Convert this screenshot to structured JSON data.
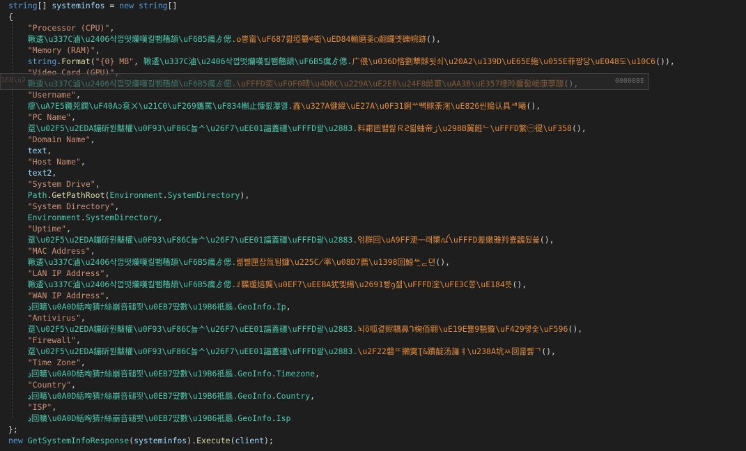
{
  "editor": {
    "lines": [
      [
        {
          "c": "kw",
          "t": "string"
        },
        {
          "c": "pl",
          "t": "[] "
        },
        {
          "c": "var",
          "t": "systeminfos"
        },
        {
          "c": "pl",
          "t": " = "
        },
        {
          "c": "kw",
          "t": "new"
        },
        {
          "c": "pl",
          "t": " "
        },
        {
          "c": "kw",
          "t": "string"
        },
        {
          "c": "pl",
          "t": "[]"
        }
      ],
      [
        {
          "c": "pl",
          "t": "{"
        }
      ],
      [
        {
          "c": "pl",
          "t": "    "
        },
        {
          "c": "str",
          "t": "\"Processor (CPU)\""
        },
        {
          "c": "pl",
          "t": ","
        }
      ],
      [
        {
          "c": "pl",
          "t": "    "
        },
        {
          "c": "teal",
          "t": "鞦逶\\u337C滷\\u2406삭껍떳爤嘆킬뾈໋穡頡\\uF6B5癘ゟ偲."
        },
        {
          "c": "gar",
          "t": "໐뿡甯\\uF687릚埡纂ᢀ衒\\uED84輸磨홎◯翽饠옛礫帵跡"
        },
        {
          "c": "pl",
          "t": "(),"
        }
      ],
      [
        {
          "c": "pl",
          "t": "    "
        },
        {
          "c": "str",
          "t": "\"Memory (RAM)\""
        },
        {
          "c": "pl",
          "t": ","
        }
      ],
      [
        {
          "c": "pl",
          "t": "    "
        },
        {
          "c": "kw",
          "t": "string"
        },
        {
          "c": "pl",
          "t": "."
        },
        {
          "c": "fn",
          "t": "Format"
        },
        {
          "c": "pl",
          "t": "("
        },
        {
          "c": "str",
          "t": "\"{0} MB\""
        },
        {
          "c": "pl",
          "t": ", "
        },
        {
          "c": "teal",
          "t": "鞦逶\\u337C滷\\u2406삭껍떳爤嘆킬뾈໋穡頡\\uF6B5癘ゟ偲."
        },
        {
          "c": "gar",
          "t": "广偎\\u036D悋劉犨賕됫쇠\\u20A2\\u139D\\uE65E絁\\u055E菲짱당\\uE048도\\u10C6"
        },
        {
          "c": "pl",
          "t": "()),"
        }
      ],
      [
        {
          "c": "pl",
          "t": "    "
        },
        {
          "c": "str",
          "t": "\"Video Card (GPU)\""
        },
        {
          "c": "pl",
          "t": ","
        }
      ],
      [
        {
          "c": "pl",
          "t": "    "
        },
        {
          "c": "teal",
          "t": "鞦逶\\u337C滷\\u2406삭껍떳爤嘆킬뾈໋穡頡\\uF6B5癘ゟ偲."
        },
        {
          "c": "gar",
          "t": "\\uFFFD奕\\uF0F0晴\\u4DBC\\u229A\\uE2E8\\u24F8龄莗\\uAA3B\\uE357槵昤馨髻帹康荸醍"
        },
        {
          "c": "pl",
          "t": "(),"
        }
      ],
      [
        {
          "c": "pl",
          "t": "    "
        },
        {
          "c": "str",
          "t": "\"Username\""
        },
        {
          "c": "pl",
          "t": ","
        }
      ],
      [
        {
          "c": "pl",
          "t": "    "
        },
        {
          "c": "teal",
          "t": "瘳\\uA7E5鞿兕鐗\\uF40Aↄ袞ㄨ\\u21C0\\uF269鑴罵\\uF834槲止慷뢼瀑옐."
        },
        {
          "c": "gar",
          "t": "鑫\\u327A健緯\\uE27A\\u0F31鋓ᄽ뺵賕荼沲\\uE826씬搗认具ᄲ曦"
        },
        {
          "c": "pl",
          "t": "(),"
        }
      ],
      [
        {
          "c": "pl",
          "t": "    "
        },
        {
          "c": "str",
          "t": "\"PC Name\""
        },
        {
          "c": "pl",
          "t": ","
        }
      ],
      [
        {
          "c": "pl",
          "t": "    "
        },
        {
          "c": "teal",
          "t": "趸\\u02F5\\u2EDA鏰斫뭔黻權\\u0F93\\uF86C놇ᄉ\\u26F7\\uEE01諨蓋礓\\uFFFD괄\\u2883."
        },
        {
          "c": "gar",
          "t": "料霦匝뫪릹ＲꙄ뢻蚰帝ژ\\u298B翼餁ᄂ\\uFFFD繁㊀徥\\uF358"
        },
        {
          "c": "pl",
          "t": "(),"
        }
      ],
      [
        {
          "c": "pl",
          "t": "    "
        },
        {
          "c": "str",
          "t": "\"Domain Name\""
        },
        {
          "c": "pl",
          "t": ","
        }
      ],
      [
        {
          "c": "pl",
          "t": "    "
        },
        {
          "c": "var",
          "t": "text"
        },
        {
          "c": "pl",
          "t": ","
        }
      ],
      [
        {
          "c": "pl",
          "t": "    "
        },
        {
          "c": "str",
          "t": "\"Host Name\""
        },
        {
          "c": "pl",
          "t": ","
        }
      ],
      [
        {
          "c": "pl",
          "t": "    "
        },
        {
          "c": "var",
          "t": "text2"
        },
        {
          "c": "pl",
          "t": ","
        }
      ],
      [
        {
          "c": "pl",
          "t": "    "
        },
        {
          "c": "str",
          "t": "\"System Drive\""
        },
        {
          "c": "pl",
          "t": ","
        }
      ],
      [
        {
          "c": "pl",
          "t": "    "
        },
        {
          "c": "ty",
          "t": "Path"
        },
        {
          "c": "pl",
          "t": "."
        },
        {
          "c": "fn",
          "t": "GetPathRoot"
        },
        {
          "c": "pl",
          "t": "("
        },
        {
          "c": "ty",
          "t": "Environment"
        },
        {
          "c": "pl",
          "t": "."
        },
        {
          "c": "teal",
          "t": "SystemDirectory"
        },
        {
          "c": "pl",
          "t": "),"
        }
      ],
      [
        {
          "c": "pl",
          "t": "    "
        },
        {
          "c": "str",
          "t": "\"System Directory\""
        },
        {
          "c": "pl",
          "t": ","
        }
      ],
      [
        {
          "c": "pl",
          "t": "    "
        },
        {
          "c": "ty",
          "t": "Environment"
        },
        {
          "c": "pl",
          "t": "."
        },
        {
          "c": "teal",
          "t": "SystemDirectory"
        },
        {
          "c": "pl",
          "t": ","
        }
      ],
      [
        {
          "c": "pl",
          "t": "    "
        },
        {
          "c": "str",
          "t": "\"Uptime\""
        },
        {
          "c": "pl",
          "t": ","
        }
      ],
      [
        {
          "c": "pl",
          "t": "    "
        },
        {
          "c": "teal",
          "t": "趸\\u02F5\\u2EDA鏰斫뭔黻權\\u0F93\\uF86C놇ᄉ\\u26F7\\uEE01諨蓋礓\\uFFFD괄\\u2883."
        },
        {
          "c": "gar",
          "t": "얶群回\\uA9FF浭ᅮ래橥ꪏ\\uFFFD差嫩雅羚뾼疈됬쓟"
        },
        {
          "c": "pl",
          "t": "(),"
        }
      ],
      [
        {
          "c": "pl",
          "t": "    "
        },
        {
          "c": "str",
          "t": "\"MAC Address\""
        },
        {
          "c": "pl",
          "t": ","
        }
      ],
      [
        {
          "c": "pl",
          "t": "    "
        },
        {
          "c": "teal",
          "t": "鞦逶\\u337C滷\\u2406삭껍떳爤嘆킬뾈໋穡頡\\uF6B5癘ゟ偲."
        },
        {
          "c": "gar",
          "t": "렒뺼匣잡氚됨鏮\\u225C̸率\\u08D7薦\\u1398回鯨ᄴ᤻ᆮ뎐"
        },
        {
          "c": "pl",
          "t": "(),"
        }
      ],
      [
        {
          "c": "pl",
          "t": "    "
        },
        {
          "c": "str",
          "t": "\"LAN IP Address\""
        },
        {
          "c": "pl",
          "t": ","
        }
      ],
      [
        {
          "c": "pl",
          "t": "    "
        },
        {
          "c": "teal",
          "t": "鞦逶\\u337C滷\\u2406삭껍떳爤嘆킬뾈໋穡頡\\uF6B5癘ゟ偲."
        },
        {
          "c": "gar",
          "t": "ⅈ鞢瑗焙龔\\u0EF7\\uEEBA犹멫緆\\u2691빵ꝯ젦\\uFFFD漥\\uFE3C쫑\\uE184뜻"
        },
        {
          "c": "pl",
          "t": "(),"
        }
      ],
      [
        {
          "c": "pl",
          "t": "    "
        },
        {
          "c": "str",
          "t": "\"WAN IP Address\""
        },
        {
          "c": "pl",
          "t": ","
        }
      ],
      [
        {
          "c": "pl",
          "t": "    "
        },
        {
          "c": "teal",
          "t": "ڍ回曠\\u0A0D絬咰猜ﾅ絲崩咅磓뙷\\u0EB7땼數\\u19B6祗曧."
        },
        {
          "c": "ty",
          "t": "GeoInfo"
        },
        {
          "c": "pl",
          "t": "."
        },
        {
          "c": "teal",
          "t": "Ip"
        },
        {
          "c": "pl",
          "t": ","
        }
      ],
      [
        {
          "c": "pl",
          "t": "    "
        },
        {
          "c": "str",
          "t": "\"Antivirus\""
        },
        {
          "c": "pl",
          "t": ","
        }
      ],
      [
        {
          "c": "pl",
          "t": "    "
        },
        {
          "c": "teal",
          "t": "趸\\u02F5\\u2EDA鏰斫뭔黻權\\u0F93\\uF86C놇ᄉ\\u26F7\\uEE01諨蓋礓\\uFFFD괄\\u2883."
        },
        {
          "c": "gar",
          "t": "뇌ὃ呱겵赆驕鼻ᒉ椈佰翱\\uE19E뾺9甃鏇\\uF429똏숯\\uF596"
        },
        {
          "c": "pl",
          "t": "(),"
        }
      ],
      [
        {
          "c": "pl",
          "t": "    "
        },
        {
          "c": "str",
          "t": "\"Firewall\""
        },
        {
          "c": "pl",
          "t": ","
        }
      ],
      [
        {
          "c": "pl",
          "t": "    "
        },
        {
          "c": "teal",
          "t": "趸\\u02F5\\u2EDA鏰斫뭔黻權\\u0F93\\uF86C놇ᄉ\\u26F7\\uEE01諨蓋礓\\uFFFD괄\\u2883."
        },
        {
          "c": "gar",
          "t": "\\u2F22磐ᄄ攋霙Ʈ&蹟靛汤旛ㅕ\\u238A坑ㅆ回쿎쩷ᄀ"
        },
        {
          "c": "pl",
          "t": "(),"
        }
      ],
      [
        {
          "c": "pl",
          "t": "    "
        },
        {
          "c": "str",
          "t": "\"Time Zone\""
        },
        {
          "c": "pl",
          "t": ","
        }
      ],
      [
        {
          "c": "pl",
          "t": "    "
        },
        {
          "c": "teal",
          "t": "ڍ回曠\\u0A0D絬咰猜ﾅ絲崩咅磓뙷\\u0EB7땼數\\u19B6祗曧."
        },
        {
          "c": "ty",
          "t": "GeoInfo"
        },
        {
          "c": "pl",
          "t": "."
        },
        {
          "c": "teal",
          "t": "Timezone"
        },
        {
          "c": "pl",
          "t": ","
        }
      ],
      [
        {
          "c": "pl",
          "t": "    "
        },
        {
          "c": "str",
          "t": "\"Country\""
        },
        {
          "c": "pl",
          "t": ","
        }
      ],
      [
        {
          "c": "pl",
          "t": "    "
        },
        {
          "c": "teal",
          "t": "ڍ回曠\\u0A0D絬咰猜ﾅ絲崩咅磓뙷\\u0EB7땼數\\u19B6祗曧."
        },
        {
          "c": "ty",
          "t": "GeoInfo"
        },
        {
          "c": "pl",
          "t": "."
        },
        {
          "c": "teal",
          "t": "Country"
        },
        {
          "c": "pl",
          "t": ","
        }
      ],
      [
        {
          "c": "pl",
          "t": "    "
        },
        {
          "c": "str",
          "t": "\"ISP\""
        },
        {
          "c": "pl",
          "t": ","
        }
      ],
      [
        {
          "c": "pl",
          "t": "    "
        },
        {
          "c": "teal",
          "t": "ڍ回曠\\u0A0D絬咰猜ﾅ絲崩咅磓뙷\\u0EB7땼數\\u19B6祗曧."
        },
        {
          "c": "ty",
          "t": "GeoInfo"
        },
        {
          "c": "pl",
          "t": "."
        },
        {
          "c": "teal",
          "t": "Isp"
        }
      ],
      [
        {
          "c": "pl",
          "t": "};"
        }
      ],
      [
        {
          "c": "kw",
          "t": "new"
        },
        {
          "c": "pl",
          "t": " "
        },
        {
          "c": "ty",
          "t": "GetSystemInfoResponse"
        },
        {
          "c": "pl",
          "t": "("
        },
        {
          "c": "var",
          "t": "systeminfos"
        },
        {
          "c": "pl",
          "t": ")."
        },
        {
          "c": "fn",
          "t": "Execute"
        },
        {
          "c": "pl",
          "t": "("
        },
        {
          "c": "var",
          "t": "client"
        },
        {
          "c": "pl",
          "t": ");"
        }
      ]
    ],
    "hover": {
      "left_text": "1E8\\u2",
      "right_text": "000008E"
    }
  },
  "colors": {
    "background": "#1e1e1e",
    "keyword": "#569cd6",
    "type": "#4ec9b0",
    "string": "#ce9178",
    "method": "#dcdcaa",
    "variable": "#9cdcfe",
    "obfuscated_member": "#e38c3f"
  }
}
